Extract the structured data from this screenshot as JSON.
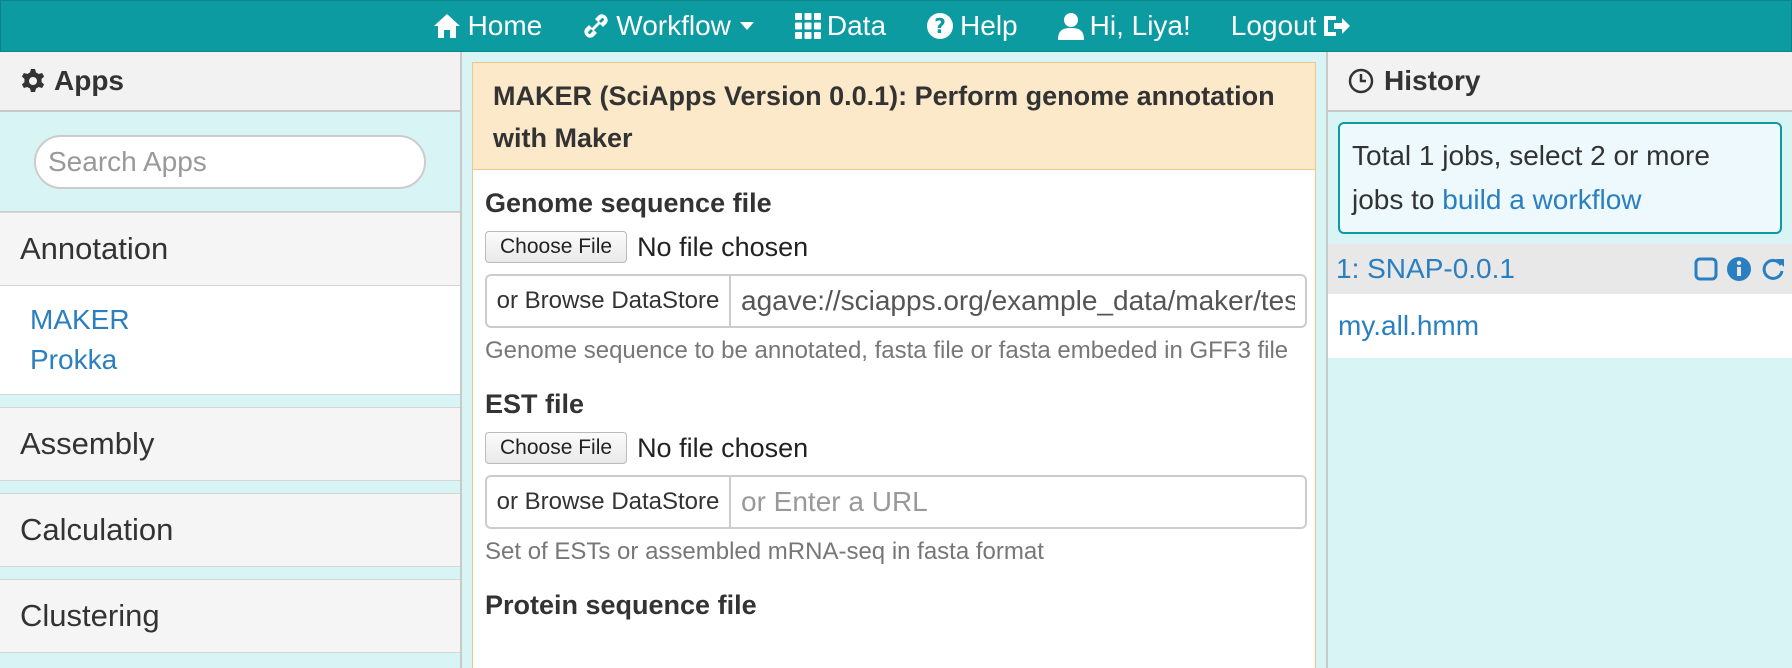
{
  "nav": {
    "home_label": "Home",
    "workflow_label": "Workflow",
    "data_label": "Data",
    "help_label": "Help",
    "user_label": "Hi, Liya!",
    "logout_label": "Logout",
    "bar_color": "#0c9ba0"
  },
  "apps_panel": {
    "title": "Apps",
    "search_placeholder": "Search Apps",
    "categories": [
      {
        "label": "Annotation",
        "expanded": true,
        "items": [
          "MAKER",
          "Prokka"
        ]
      },
      {
        "label": "Assembly",
        "expanded": false
      },
      {
        "label": "Calculation",
        "expanded": false
      },
      {
        "label": "Clustering",
        "expanded": false
      }
    ]
  },
  "form": {
    "title": "MAKER (SciApps Version 0.0.1): Perform genome annotation with Maker",
    "fields": [
      {
        "label": "Genome sequence file",
        "choose_label": "Choose File",
        "file_status": "No file chosen",
        "browse_label": "or Browse DataStore",
        "url_value": "agave://sciapps.org/example_data/maker/test_genome.fasta",
        "url_placeholder": "or Enter a URL",
        "help": "Genome sequence to be annotated, fasta file or fasta embeded in GFF3 file"
      },
      {
        "label": "EST file",
        "choose_label": "Choose File",
        "file_status": "No file chosen",
        "browse_label": "or Browse DataStore",
        "url_value": "",
        "url_placeholder": "or Enter a URL",
        "help": "Set of ESTs or assembled mRNA-seq in fasta format"
      },
      {
        "label": "Protein sequence file"
      }
    ]
  },
  "history": {
    "title": "History",
    "info_text": "Total 1 jobs, select 2 or more jobs to ",
    "info_link": "build a workflow",
    "job": {
      "name": "1: SNAP-0.0.1",
      "output": "my.all.hmm"
    }
  },
  "colors": {
    "accent": "#0c9ba0",
    "link": "#2a7fc0",
    "title_bg": "#fbe9c9",
    "panel_bg": "#d9f4f4"
  }
}
